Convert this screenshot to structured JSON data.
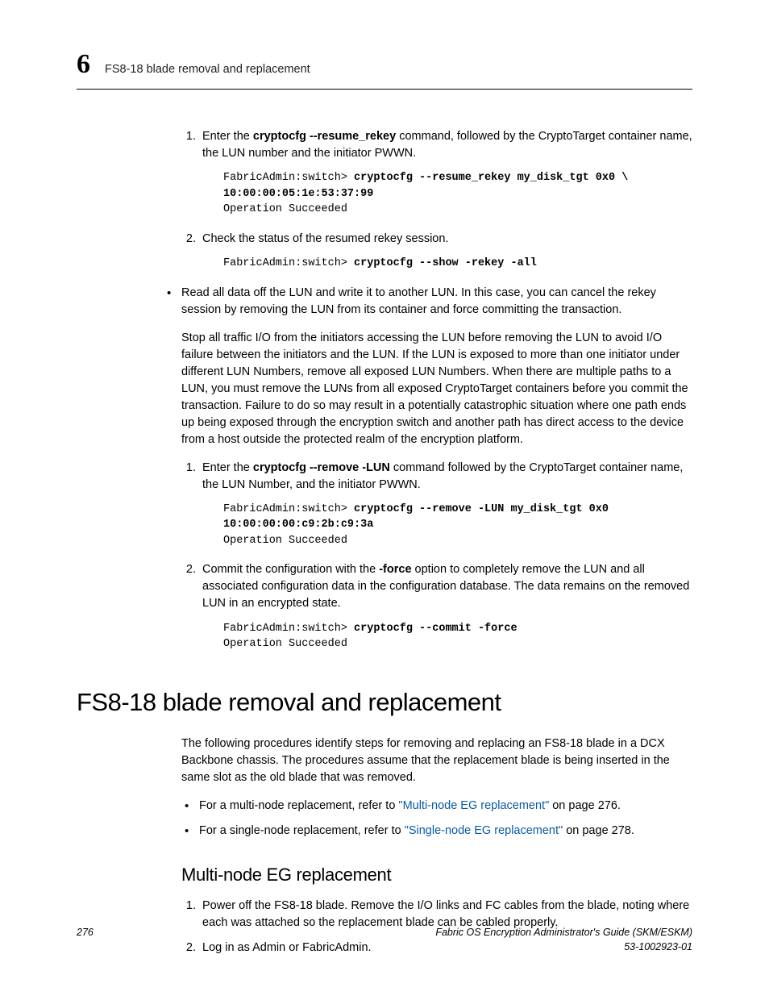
{
  "header": {
    "chapter_number": "6",
    "title": "FS8-18 blade removal and replacement"
  },
  "step1": {
    "intro_a": "Enter the ",
    "cmd": "cryptocfg --resume_rekey",
    "intro_b": " command, followed by the CryptoTarget container name, the LUN number and the initiator PWWN.",
    "code_prefix": "FabricAdmin:switch> ",
    "code_bold_l1": "cryptocfg --resume_rekey my_disk_tgt 0x0 \\",
    "code_bold_l2": "10:00:00:05:1e:53:37:99",
    "code_result": "Operation Succeeded"
  },
  "step2": {
    "text": "Check the status of the resumed rekey session.",
    "code_prefix": "FabricAdmin:switch> ",
    "code_bold": "cryptocfg --show -rekey -all"
  },
  "bullet1": {
    "p1": "Read all data off the LUN and write it to another LUN. In this case, you can cancel the rekey session by removing the LUN from its container and force committing the transaction.",
    "p2": "Stop all traffic I/O from the initiators accessing the LUN before removing the LUN to avoid I/O failure between the initiators and the LUN. If the LUN is exposed to more than one initiator under different LUN Numbers, remove all exposed LUN Numbers. When there are multiple paths to a LUN, you must remove the LUNs from all exposed CryptoTarget containers before you commit the transaction. Failure to do so may result in a potentially catastrophic situation where one path ends up being exposed through the encryption switch and another path has direct access to the device from a host outside the protected realm of the encryption platform."
  },
  "sub1": {
    "intro_a": "Enter the ",
    "cmd": "cryptocfg --remove -LUN",
    "intro_b": " command followed by the CryptoTarget container name, the LUN Number, and the initiator PWWN.",
    "code_prefix": "FabricAdmin:switch> ",
    "code_bold_l1": "cryptocfg --remove -LUN my_disk_tgt 0x0",
    "code_bold_l2": "10:00:00:00:c9:2b:c9:3a",
    "code_result": "Operation Succeeded"
  },
  "sub2": {
    "intro_a": "Commit the configuration with the ",
    "cmd": "-force",
    "intro_b": " option to completely remove the LUN and all associated configuration data in the configuration database. The data remains on the removed LUN in an encrypted state.",
    "code_prefix": "FabricAdmin:switch> ",
    "code_bold": "cryptocfg --commit -force",
    "code_result": "Operation Succeeded"
  },
  "section": {
    "title": "FS8-18 blade removal and replacement",
    "intro": "The following procedures identify steps for removing and replacing an FS8-18 blade in a DCX Backbone chassis. The procedures assume that the replacement blade is being inserted in the same slot as the old blade that was removed.",
    "b1a": "For a multi-node replacement, refer to ",
    "b1link": "\"Multi-node EG replacement\"",
    "b1b": " on page 276.",
    "b2a": "For a single-node replacement, refer to ",
    "b2link": "\"Single-node EG replacement\"",
    "b2b": " on page 278."
  },
  "subsection": {
    "title": "Multi-node EG replacement",
    "s1": "Power off the FS8-18 blade. Remove the I/O links and FC cables from the blade, noting where each was attached so the replacement blade can be cabled properly.",
    "s2": "Log in as Admin or FabricAdmin."
  },
  "footer": {
    "page": "276",
    "doc_title": "Fabric OS Encryption Administrator's Guide (SKM/ESKM)",
    "doc_num": "53-1002923-01"
  }
}
